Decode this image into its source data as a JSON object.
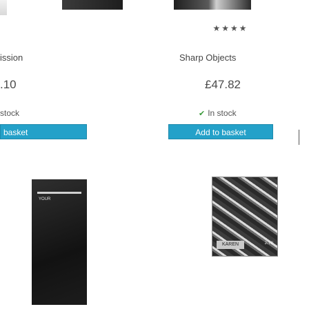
{
  "products": [
    {
      "title": "ission",
      "price": ".10",
      "stock": "stock",
      "button_label": "basket"
    },
    {
      "rating": "★★★★",
      "title": "Sharp Objects",
      "price": "£47.82",
      "stock_icon": "check-icon",
      "stock": "In stock",
      "button_label": "Add to basket",
      "cover_badge": "KAREN",
      "cover_author": "J. HI"
    }
  ],
  "bottom_left_cover_tag": "YOUR",
  "colors": {
    "button_bg": "#24a1c9",
    "button_text": "#ffffff",
    "in_stock_check": "#3a9a3a",
    "text": "#444444"
  }
}
